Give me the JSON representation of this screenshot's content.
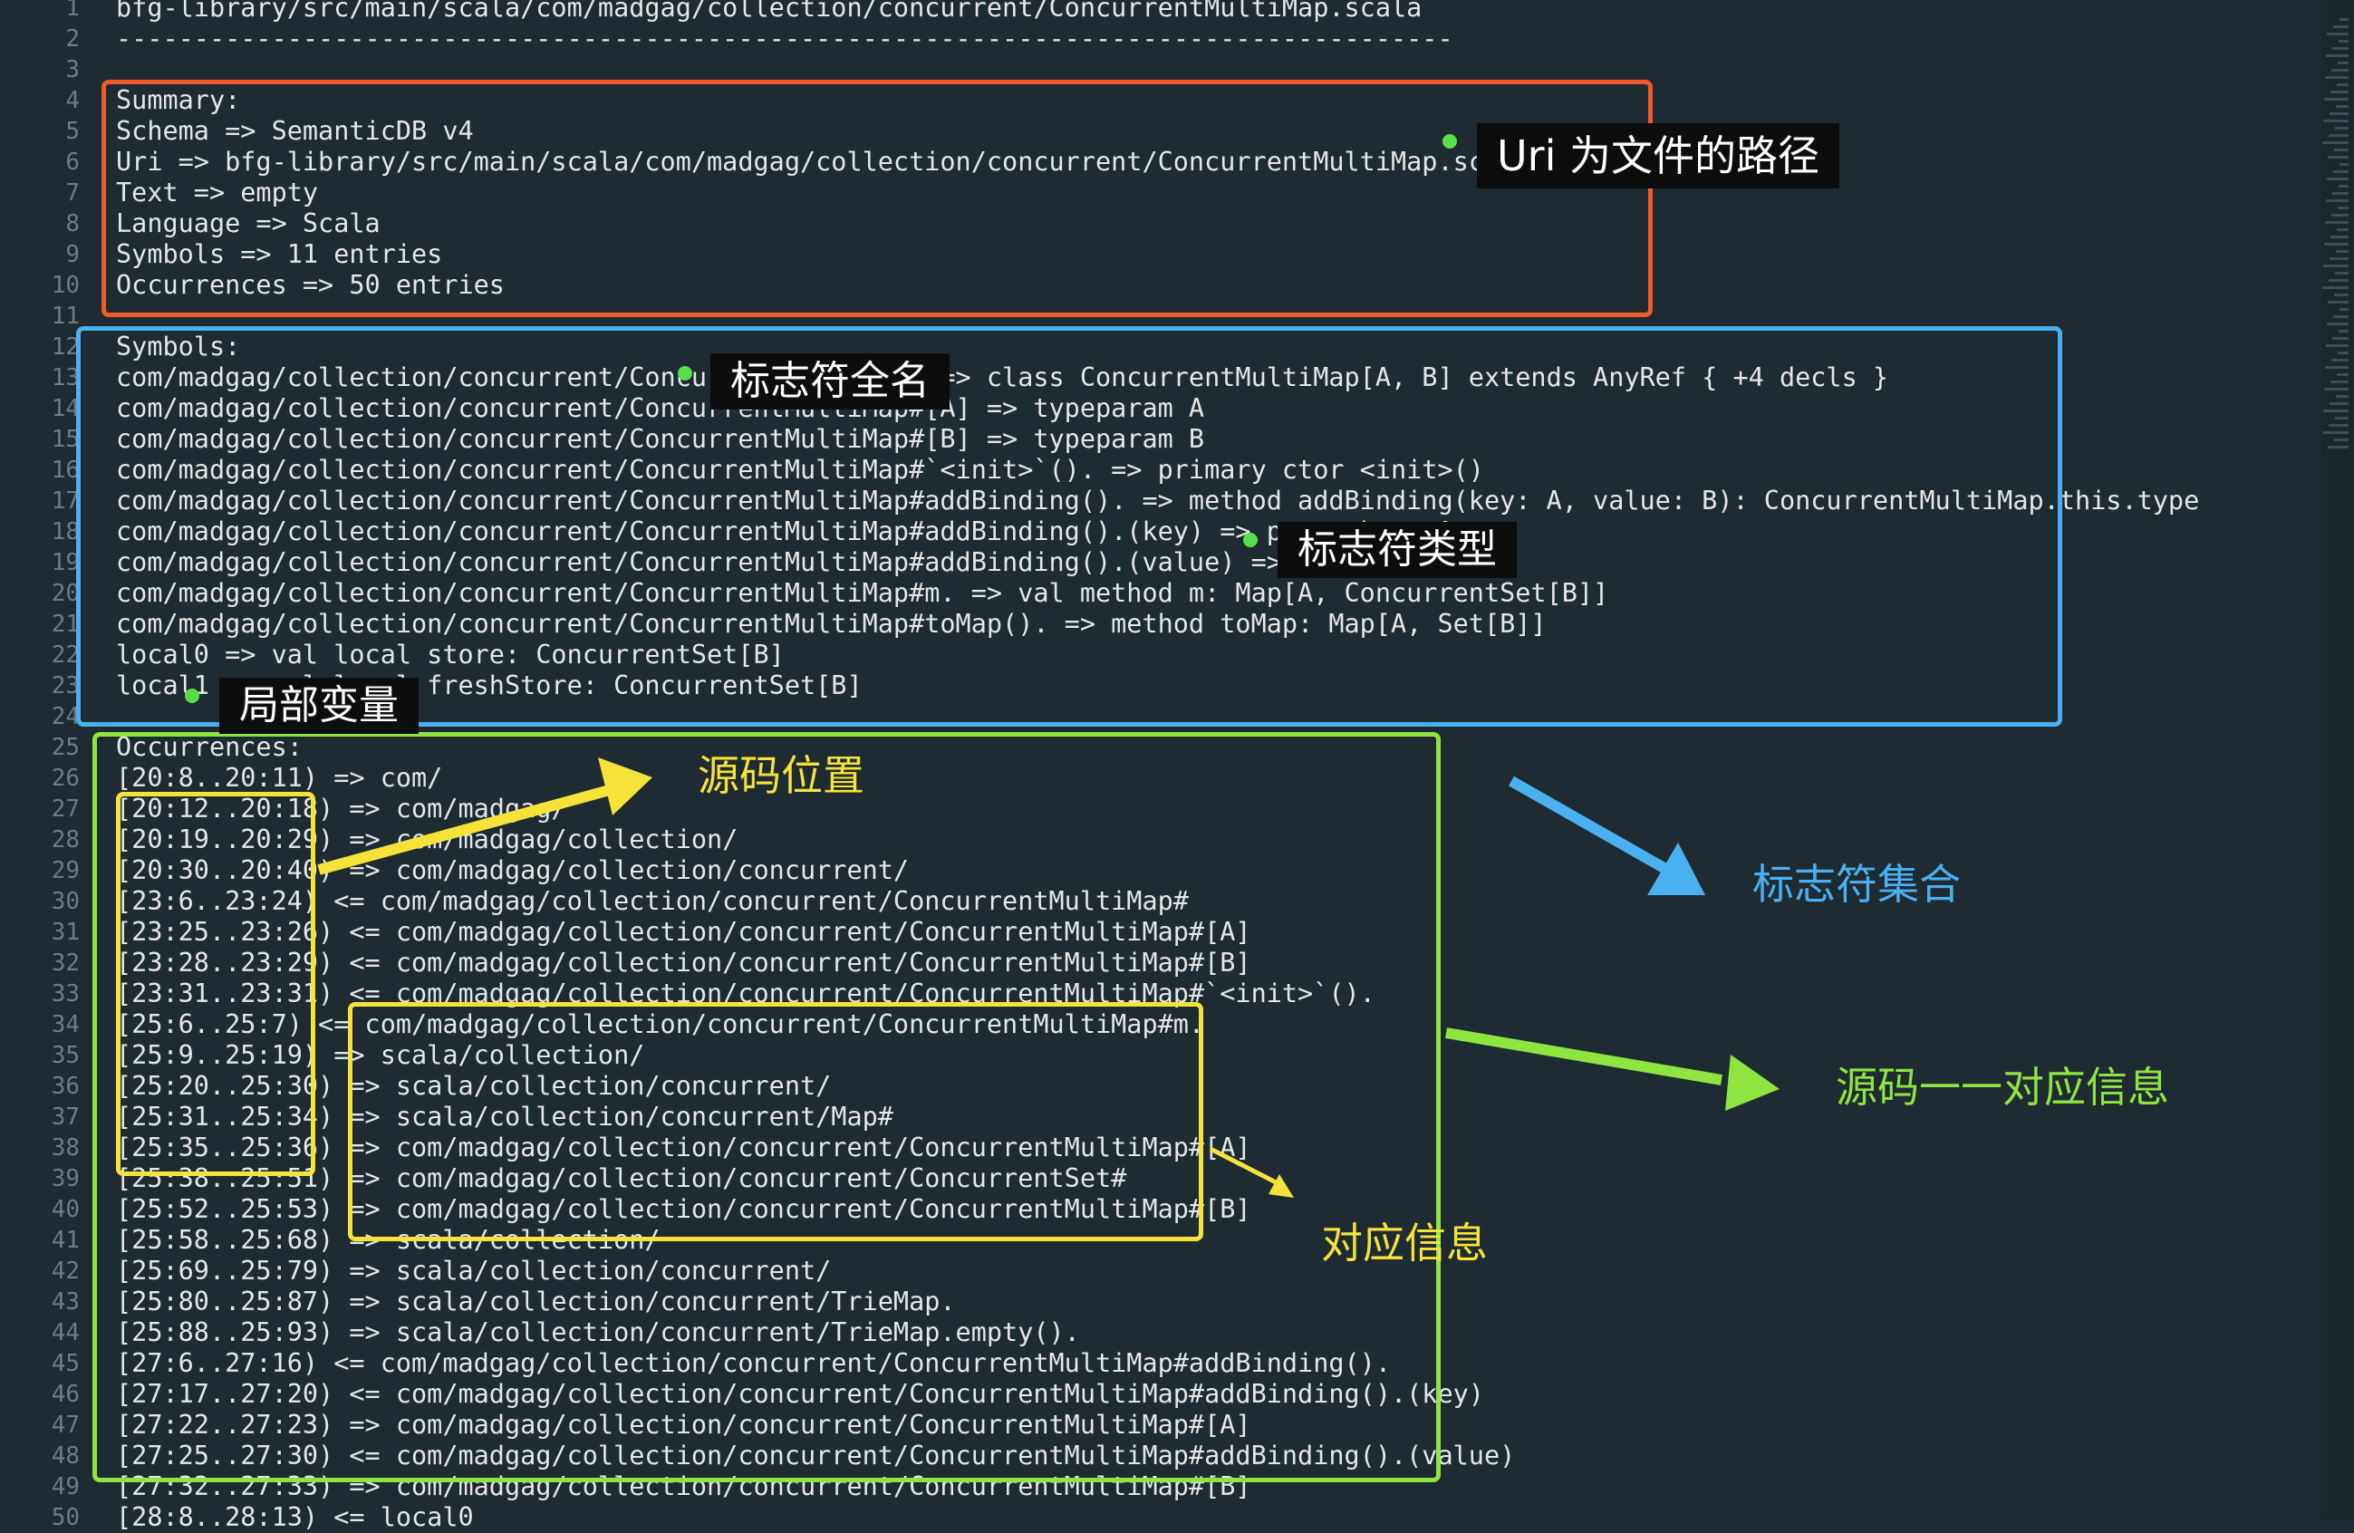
{
  "lines": [
    {
      "n": "1",
      "t": "bfg-library/src/main/scala/com/madgag/collection/concurrent/ConcurrentMultiMap.scala"
    },
    {
      "n": "2",
      "t": "--------------------------------------------------------------------------------------"
    },
    {
      "n": "3",
      "t": ""
    },
    {
      "n": "4",
      "t": "Summary:"
    },
    {
      "n": "5",
      "t": "Schema => SemanticDB v4"
    },
    {
      "n": "6",
      "t": "Uri => bfg-library/src/main/scala/com/madgag/collection/concurrent/ConcurrentMultiMap.scala"
    },
    {
      "n": "7",
      "t": "Text => empty"
    },
    {
      "n": "8",
      "t": "Language => Scala"
    },
    {
      "n": "9",
      "t": "Symbols => 11 entries"
    },
    {
      "n": "10",
      "t": "Occurrences => 50 entries"
    },
    {
      "n": "11",
      "t": ""
    },
    {
      "n": "12",
      "t": "Symbols:"
    },
    {
      "n": "13",
      "t": "com/madgag/collection/concurrent/ConcurrentMultiMap# => class ConcurrentMultiMap[A, B] extends AnyRef { +4 decls }"
    },
    {
      "n": "14",
      "t": "com/madgag/collection/concurrent/ConcurrentMultiMap#[A] => typeparam A"
    },
    {
      "n": "15",
      "t": "com/madgag/collection/concurrent/ConcurrentMultiMap#[B] => typeparam B"
    },
    {
      "n": "16",
      "t": "com/madgag/collection/concurrent/ConcurrentMultiMap#`<init>`(). => primary ctor <init>()"
    },
    {
      "n": "17",
      "t": "com/madgag/collection/concurrent/ConcurrentMultiMap#addBinding(). => method addBinding(key: A, value: B): ConcurrentMultiMap.this.type"
    },
    {
      "n": "18",
      "t": "com/madgag/collection/concurrent/ConcurrentMultiMap#addBinding().(key) => param key: A"
    },
    {
      "n": "19",
      "t": "com/madgag/collection/concurrent/ConcurrentMultiMap#addBinding().(value) => param value: B"
    },
    {
      "n": "20",
      "t": "com/madgag/collection/concurrent/ConcurrentMultiMap#m. => val method m: Map[A, ConcurrentSet[B]]"
    },
    {
      "n": "21",
      "t": "com/madgag/collection/concurrent/ConcurrentMultiMap#toMap(). => method toMap: Map[A, Set[B]]"
    },
    {
      "n": "22",
      "t": "local0 => val local store: ConcurrentSet[B]"
    },
    {
      "n": "23",
      "t": "local1 => val local freshStore: ConcurrentSet[B]"
    },
    {
      "n": "24",
      "t": ""
    },
    {
      "n": "25",
      "t": "Occurrences:"
    },
    {
      "n": "26",
      "t": "[20:8..20:11) => com/"
    },
    {
      "n": "27",
      "t": "[20:12..20:18) => com/madgag/"
    },
    {
      "n": "28",
      "t": "[20:19..20:29) => com/madgag/collection/"
    },
    {
      "n": "29",
      "t": "[20:30..20:40) => com/madgag/collection/concurrent/"
    },
    {
      "n": "30",
      "t": "[23:6..23:24) <= com/madgag/collection/concurrent/ConcurrentMultiMap#"
    },
    {
      "n": "31",
      "t": "[23:25..23:26) <= com/madgag/collection/concurrent/ConcurrentMultiMap#[A]"
    },
    {
      "n": "32",
      "t": "[23:28..23:29) <= com/madgag/collection/concurrent/ConcurrentMultiMap#[B]"
    },
    {
      "n": "33",
      "t": "[23:31..23:31) <= com/madgag/collection/concurrent/ConcurrentMultiMap#`<init>`()."
    },
    {
      "n": "34",
      "t": "[25:6..25:7) <= com/madgag/collection/concurrent/ConcurrentMultiMap#m."
    },
    {
      "n": "35",
      "t": "[25:9..25:19) => scala/collection/"
    },
    {
      "n": "36",
      "t": "[25:20..25:30) => scala/collection/concurrent/"
    },
    {
      "n": "37",
      "t": "[25:31..25:34) => scala/collection/concurrent/Map#"
    },
    {
      "n": "38",
      "t": "[25:35..25:36) => com/madgag/collection/concurrent/ConcurrentMultiMap#[A]"
    },
    {
      "n": "39",
      "t": "[25:38..25:51) => com/madgag/collection/concurrent/ConcurrentSet#"
    },
    {
      "n": "40",
      "t": "[25:52..25:53) => com/madgag/collection/concurrent/ConcurrentMultiMap#[B]"
    },
    {
      "n": "41",
      "t": "[25:58..25:68) => scala/collection/"
    },
    {
      "n": "42",
      "t": "[25:69..25:79) => scala/collection/concurrent/"
    },
    {
      "n": "43",
      "t": "[25:80..25:87) => scala/collection/concurrent/TrieMap."
    },
    {
      "n": "44",
      "t": "[25:88..25:93) => scala/collection/concurrent/TrieMap.empty()."
    },
    {
      "n": "45",
      "t": "[27:6..27:16) <= com/madgag/collection/concurrent/ConcurrentMultiMap#addBinding()."
    },
    {
      "n": "46",
      "t": "[27:17..27:20) <= com/madgag/collection/concurrent/ConcurrentMultiMap#addBinding().(key)"
    },
    {
      "n": "47",
      "t": "[27:22..27:23) => com/madgag/collection/concurrent/ConcurrentMultiMap#[A]"
    },
    {
      "n": "48",
      "t": "[27:25..27:30) <= com/madgag/collection/concurrent/ConcurrentMultiMap#addBinding().(value)"
    },
    {
      "n": "49",
      "t": "[27:32..27:33) => com/madgag/collection/concurrent/ConcurrentMultiMap#[B]"
    },
    {
      "n": "50",
      "t": "[28:8..28:13) <= local0"
    }
  ],
  "annotations": {
    "uri_label": "Uri 为文件的路径",
    "symbol_fullname_label": "标志符全名",
    "symbol_type_label": "标志符类型",
    "local_var_label": "局部变量",
    "source_position_caption": "源码位置",
    "symbol_set_caption": "标志符集合",
    "source_mapping_caption": "源码一一对应信息",
    "mapping_info_caption": "对应信息"
  },
  "colors": {
    "background": "#1e2b33",
    "summary_box": "#f05a28",
    "symbols_box": "#4ab0f0",
    "occurrences_box": "#8ee53f",
    "position_box": "#f5e33a",
    "symbol_set_caption": "#4ab0f0",
    "source_mapping_caption": "#8ee53f",
    "yellow_caption": "#f5e33a"
  }
}
